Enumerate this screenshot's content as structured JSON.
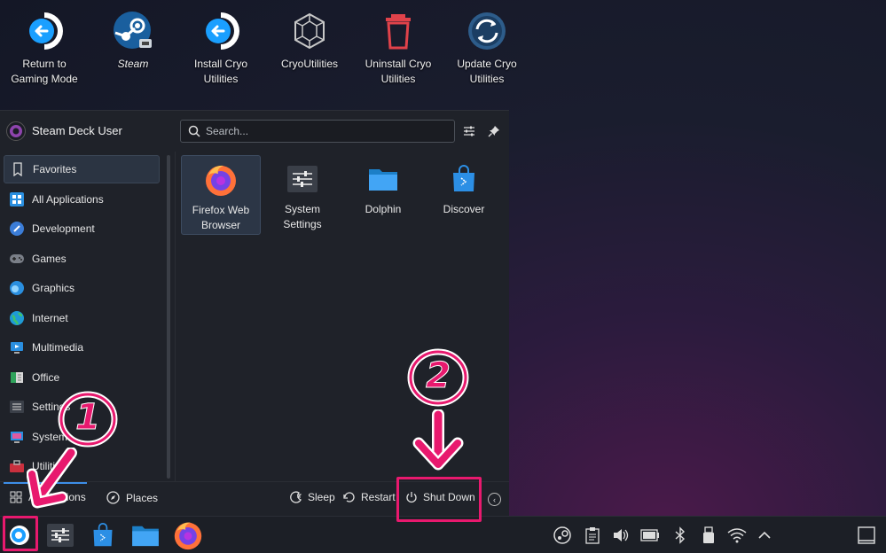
{
  "desktop": {
    "icons": [
      {
        "label_line1": "Return to",
        "label_line2": "Gaming Mode",
        "icon": "return-arrow-icon"
      },
      {
        "label_line1": "Steam",
        "label_line2": "",
        "icon": "steam-icon"
      },
      {
        "label_line1": "Install Cryo",
        "label_line2": "Utilities",
        "icon": "return-arrow-icon"
      },
      {
        "label_line1": "CryoUtilities",
        "label_line2": "",
        "icon": "cryo-hexagon-icon"
      },
      {
        "label_line1": "Uninstall Cryo",
        "label_line2": "Utilities",
        "icon": "trash-icon"
      },
      {
        "label_line1": "Update Cryo",
        "label_line2": "Utilities",
        "icon": "refresh-icon"
      }
    ]
  },
  "launcher": {
    "user_name": "Steam Deck User",
    "search_placeholder": "Search...",
    "categories": [
      {
        "label": "Favorites",
        "icon": "bookmark-icon"
      },
      {
        "label": "All Applications",
        "icon": "grid-icon"
      },
      {
        "label": "Development",
        "icon": "development-icon"
      },
      {
        "label": "Games",
        "icon": "gamepad-icon"
      },
      {
        "label": "Graphics",
        "icon": "graphics-icon"
      },
      {
        "label": "Internet",
        "icon": "globe-icon"
      },
      {
        "label": "Multimedia",
        "icon": "multimedia-icon"
      },
      {
        "label": "Office",
        "icon": "office-icon"
      },
      {
        "label": "Settings",
        "icon": "settings-icon"
      },
      {
        "label": "System",
        "icon": "system-icon"
      },
      {
        "label": "Utilities",
        "icon": "toolbox-icon"
      }
    ],
    "apps": [
      {
        "line1": "Firefox Web",
        "line2": "Browser",
        "icon": "firefox-icon"
      },
      {
        "line1": "System",
        "line2": "Settings",
        "icon": "sliders-icon"
      },
      {
        "line1": "Dolphin",
        "line2": "",
        "icon": "folder-icon"
      },
      {
        "line1": "Discover",
        "line2": "",
        "icon": "discover-bag-icon"
      }
    ],
    "footer": {
      "applications": "Applications",
      "places": "Places",
      "sleep": "Sleep",
      "restart": "Restart",
      "shutdown": "Shut Down"
    }
  },
  "annotations": {
    "step1": "1",
    "step2": "2"
  },
  "colors": {
    "accent": "#3d8ee8",
    "annotation": "#e8196e",
    "panel": "#1f2229"
  }
}
